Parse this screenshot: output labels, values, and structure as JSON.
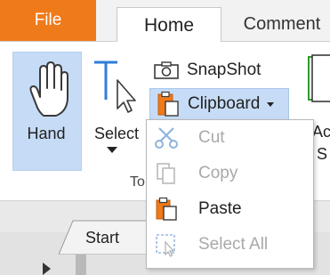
{
  "tabs": {
    "file": "File",
    "home": "Home",
    "comment": "Comment"
  },
  "ribbon": {
    "hand_label": "Hand",
    "select_label": "Select",
    "snapshot_label": "SnapShot",
    "clipboard_label": "Clipboard",
    "group_label": "To",
    "right_partial_1": "Ac",
    "right_partial_2": "S"
  },
  "document": {
    "start_tab": "Start"
  },
  "clipboard_menu": {
    "items": [
      {
        "label": "Cut",
        "icon": "scissors-icon",
        "enabled": false
      },
      {
        "label": "Copy",
        "icon": "copy-icon",
        "enabled": false
      },
      {
        "label": "Paste",
        "icon": "paste-icon",
        "enabled": true
      },
      {
        "label": "Select All",
        "icon": "select-all-icon",
        "enabled": false
      }
    ]
  },
  "colors": {
    "file_tab": "#ef7a1a",
    "highlight": "#c6dcf6",
    "icon_blue": "#2f7ed8",
    "icon_orange": "#ef7a1a",
    "disabled_text": "#a9a9a9"
  }
}
